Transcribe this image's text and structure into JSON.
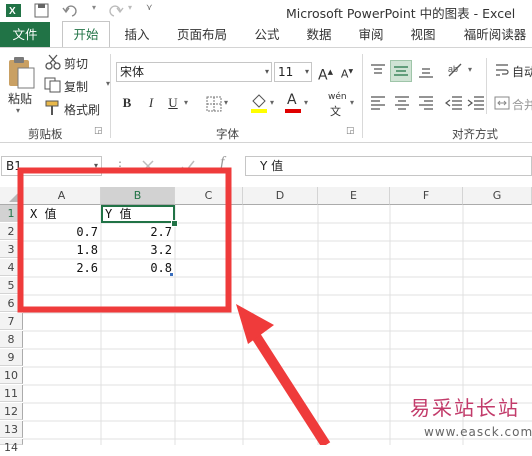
{
  "window": {
    "title": "Microsoft PowerPoint 中的图表 - Excel"
  },
  "tabs": [
    "文件",
    "开始",
    "插入",
    "页面布局",
    "公式",
    "数据",
    "审阅",
    "视图",
    "福昕阅读器"
  ],
  "clipboard": {
    "paste": "粘贴",
    "cut": "剪切",
    "copy": "复制",
    "format_painter": "格式刷",
    "group": "剪贴板"
  },
  "font": {
    "name": "宋体",
    "size": "11",
    "group": "字体",
    "bold": "B",
    "italic": "I",
    "underline": "U",
    "grow": "A",
    "shrink": "A",
    "font_color": "A",
    "wen": "wén"
  },
  "alignment": {
    "group": "对齐方式",
    "wrap": "自动",
    "merge": "合并"
  },
  "formula_bar": {
    "name_box": "B1",
    "fx": "f",
    "content": "Y 值"
  },
  "columns": [
    "A",
    "B",
    "C",
    "D",
    "E",
    "F",
    "G"
  ],
  "rows": [
    "1",
    "2",
    "3",
    "4",
    "5",
    "6",
    "7",
    "8",
    "9",
    "10",
    "11",
    "12",
    "13",
    "14"
  ],
  "cells": {
    "a1": "X 值",
    "b1": "Y 值",
    "a2": "0.7",
    "b2": "2.7",
    "a3": "1.8",
    "b3": "3.2",
    "a4": "2.6",
    "b4": "0.8"
  },
  "watermark": {
    "brand": "易采站长站",
    "url": "www.easck.com"
  },
  "colors": {
    "accent": "#217346",
    "annotation": "#ef3b3b",
    "watermark": "#c23b6a"
  }
}
